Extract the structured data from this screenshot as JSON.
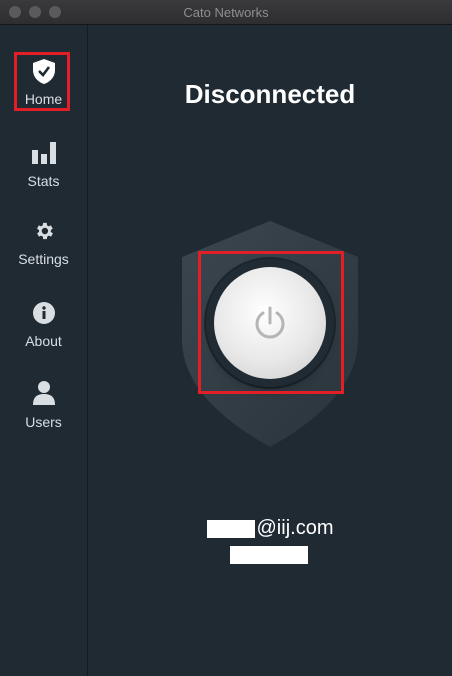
{
  "window": {
    "title": "Cato Networks"
  },
  "sidebar": {
    "items": [
      {
        "label": "Home",
        "icon": "shield-check-icon",
        "active": true
      },
      {
        "label": "Stats",
        "icon": "bar-chart-icon"
      },
      {
        "label": "Settings",
        "icon": "gear-icon"
      },
      {
        "label": "About",
        "icon": "info-icon"
      },
      {
        "label": "Users",
        "icon": "user-icon"
      }
    ]
  },
  "main": {
    "status": "Disconnected",
    "account": {
      "email_suffix": "@iij.com"
    }
  },
  "colors": {
    "highlight": "#e21e26",
    "background": "#1f2a33"
  }
}
